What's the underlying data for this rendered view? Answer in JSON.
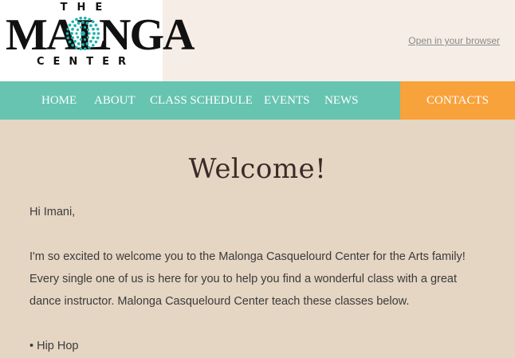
{
  "logo": {
    "top_text": "THE",
    "word_left": "MAL",
    "word_right": "NGA",
    "bottom_text": "CENTER",
    "accent_color": "#1fb3ad"
  },
  "header": {
    "open_link": "Open in your browser"
  },
  "nav": {
    "items": [
      "HOME",
      "ABOUT",
      "CLASS SCHEDULE",
      "EVENTS",
      "NEWS"
    ],
    "contacts": "CONTACTS",
    "bar_color": "#66c4b1",
    "contacts_color": "#f8a23b"
  },
  "content": {
    "title": "Welcome!",
    "greeting": "Hi Imani,",
    "paragraph_lines": [
      "I'm so excited to welcome you to the Malonga Casquelourd Center for the Arts family!",
      "Every single one of us is here for you to help you find a wonderful class with a great",
      "dance instructor. Malonga Casquelourd Center teach these classes below."
    ],
    "bullet": "• Hip Hop"
  }
}
